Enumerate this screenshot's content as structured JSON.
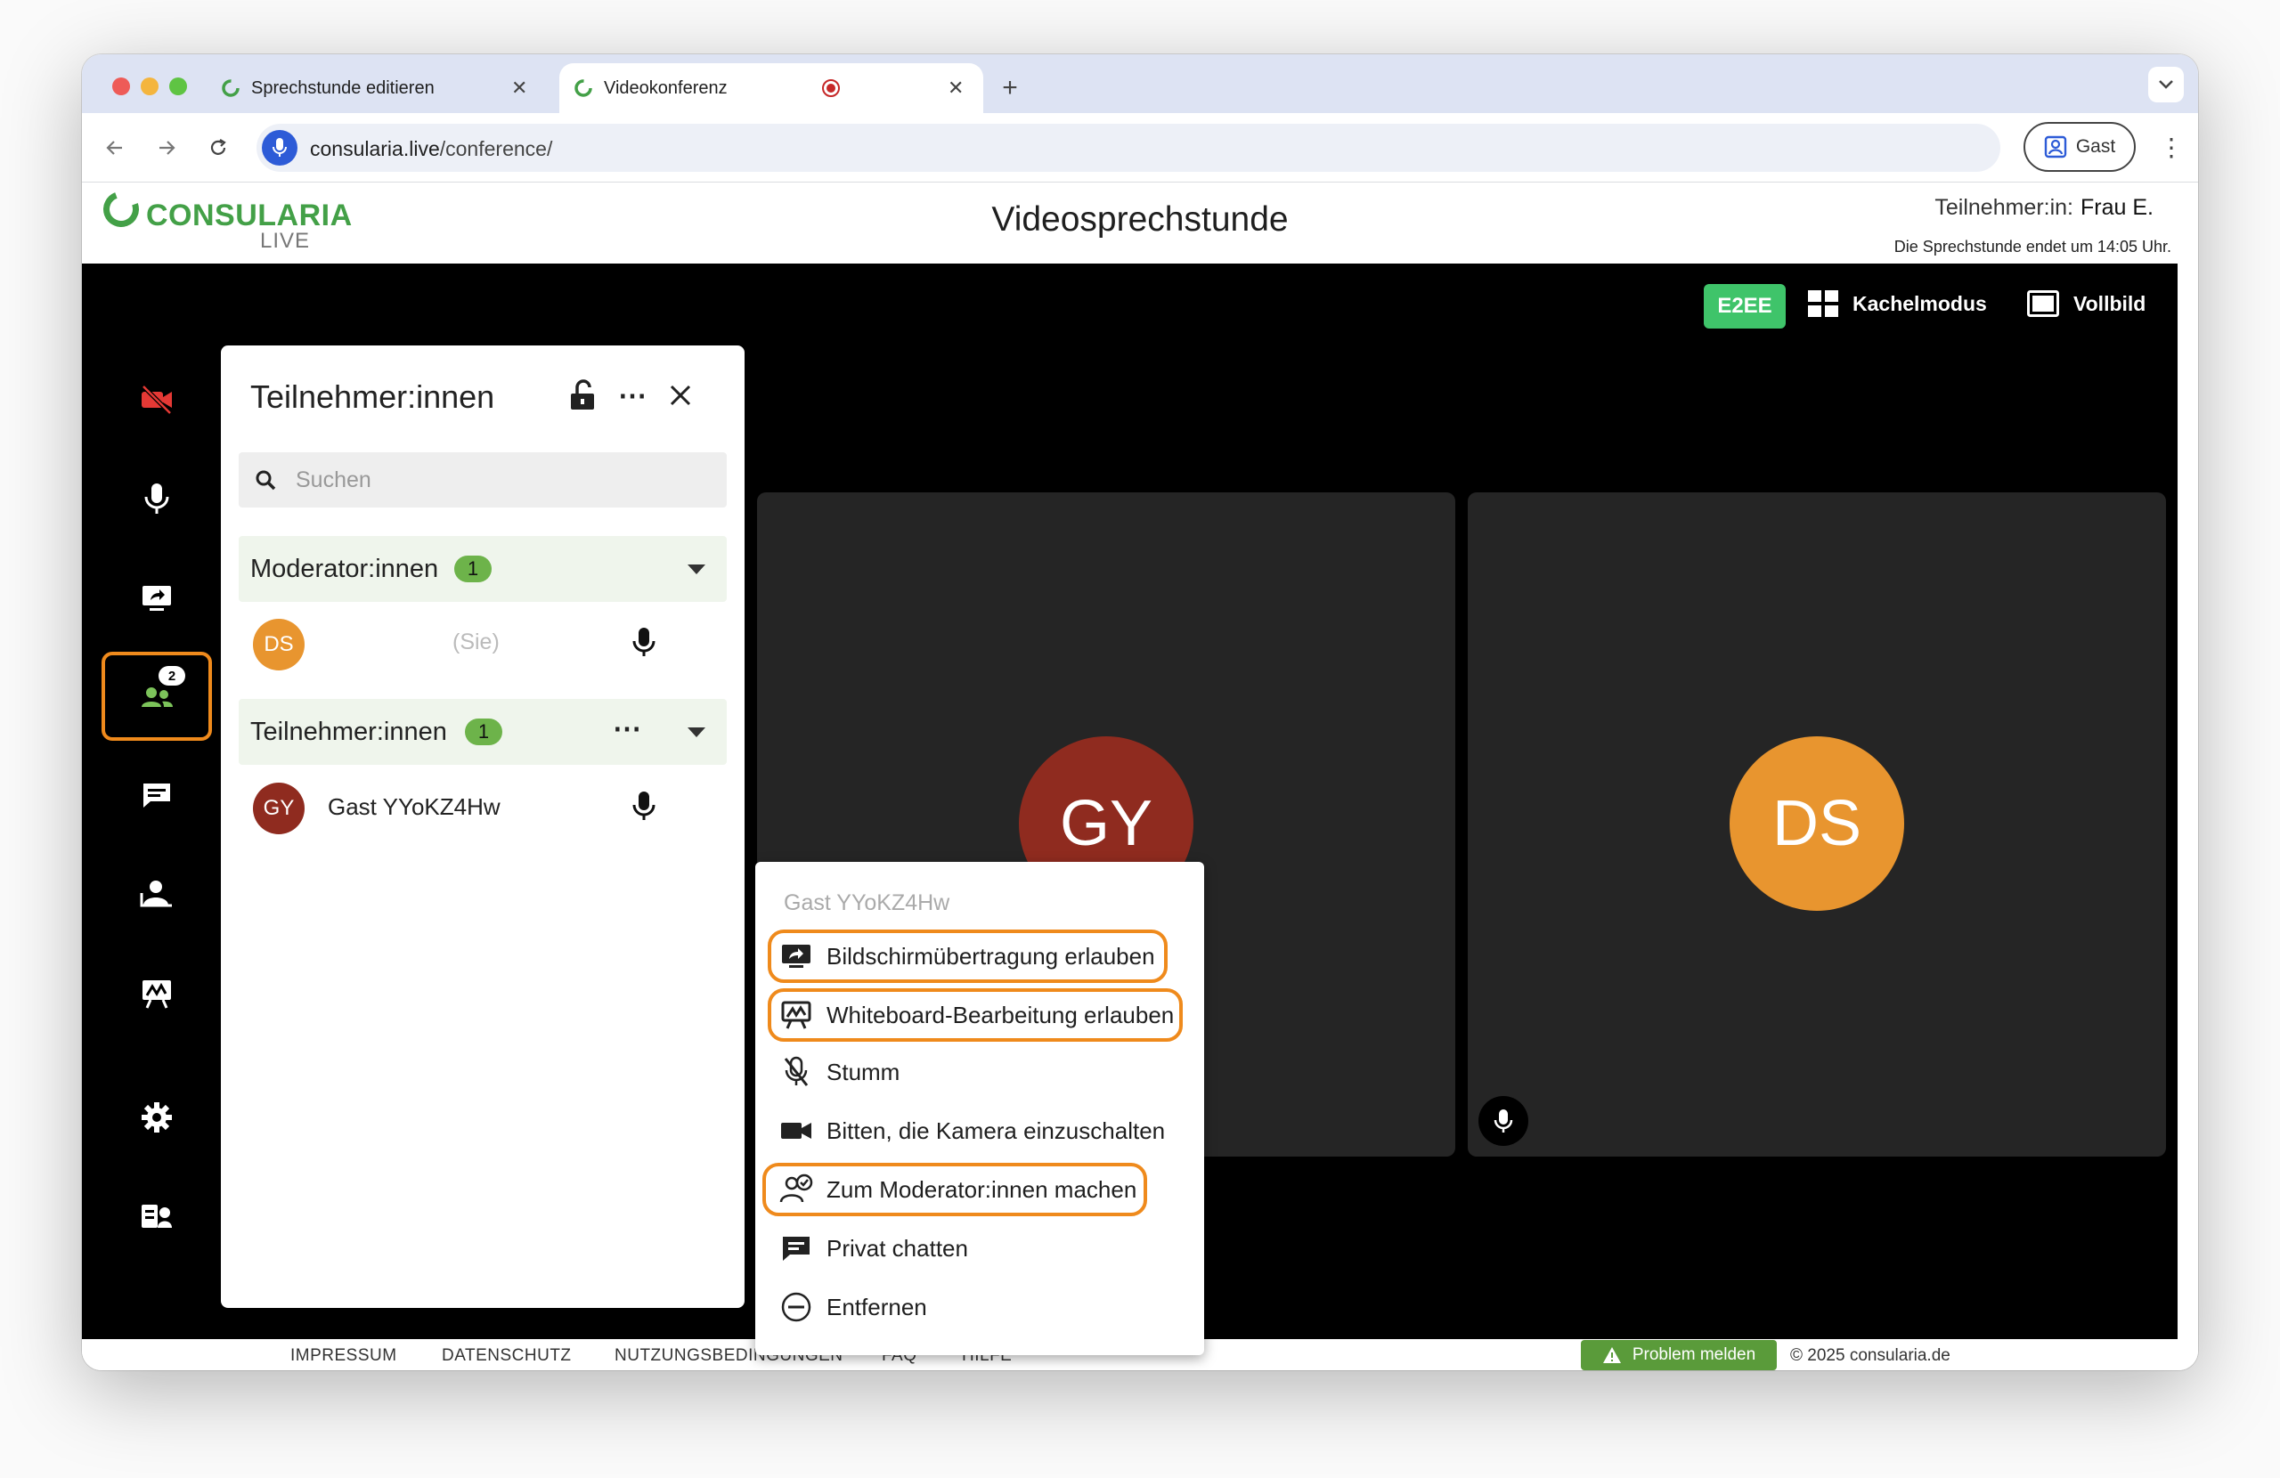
{
  "browser": {
    "tabs": [
      {
        "title": "Sprechstunde editieren",
        "active": false
      },
      {
        "title": "Videokonferenz",
        "active": true,
        "recording": true
      }
    ],
    "new_tab": "+",
    "url_host": "consularia.live",
    "url_path": "/conference/",
    "profile_label": "Gast"
  },
  "header": {
    "logo_main": "CONSULARIA",
    "logo_sub": "LIVE",
    "title": "Videosprechstunde",
    "participant_label": "Teilnehmer:in:",
    "participant_name": "Frau E.",
    "session_end": "Die Sprechstunde endet um 14:05 Uhr."
  },
  "stage_controls": {
    "e2ee": "E2EE",
    "tile_mode": "Kachelmodus",
    "fullscreen": "Vollbild"
  },
  "sidebar": {
    "participants_badge": "2"
  },
  "panel": {
    "title": "Teilnehmer:innen",
    "search_placeholder": "Suchen",
    "moderators_label": "Moderator:innen",
    "moderators_count": "1",
    "moderator": {
      "initials": "DS",
      "note": "(Sie)"
    },
    "participants_label": "Teilnehmer:innen",
    "participants_count": "1",
    "participant": {
      "initials": "GY",
      "name": "Gast YYoKZ4Hw"
    }
  },
  "tiles": {
    "left_initials": "GY",
    "right_initials": "DS"
  },
  "context_menu": {
    "title": "Gast YYoKZ4Hw",
    "items": [
      {
        "label": "Bildschirmübertragung erlauben",
        "highlighted": true
      },
      {
        "label": "Whiteboard-Bearbeitung erlauben",
        "highlighted": true
      },
      {
        "label": "Stumm",
        "highlighted": false
      },
      {
        "label": "Bitten, die Kamera einzuschalten",
        "highlighted": false
      },
      {
        "label": "Zum Moderator:innen machen",
        "highlighted": true
      },
      {
        "label": "Privat chatten",
        "highlighted": false
      },
      {
        "label": "Entfernen",
        "highlighted": false
      }
    ]
  },
  "footer": {
    "links": [
      "IMPRESSUM",
      "DATENSCHUTZ",
      "NUTZUNGSBEDINGUNGEN",
      "FAQ",
      "HILFE"
    ],
    "problem": "Problem melden",
    "copyright": "© 2025 consularia.de"
  },
  "colors": {
    "accent_green": "#43a047",
    "highlight_orange": "#ef8a1c",
    "avatar_orange": "#e8952f",
    "avatar_red": "#8f2b1f",
    "e2ee_green": "#3fc46a"
  }
}
